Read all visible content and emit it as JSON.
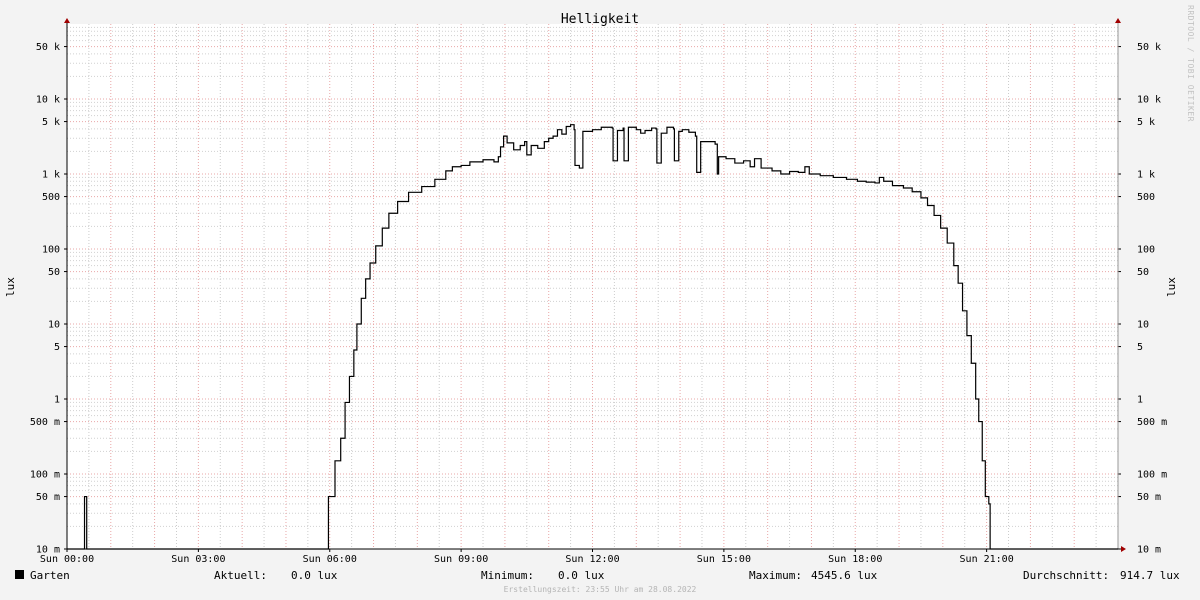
{
  "chart_data": {
    "type": "line",
    "title": "Helligkeit",
    "ylabel": "lux",
    "yscale": "log",
    "ylim": [
      0.01,
      100000
    ],
    "xlim": [
      "Sun 00:00",
      "Sun 24:00"
    ],
    "grid": true,
    "y_ticks": [
      {
        "value": 0.01,
        "label": "10 m"
      },
      {
        "value": 0.05,
        "label": "50 m"
      },
      {
        "value": 0.1,
        "label": "100 m"
      },
      {
        "value": 0.5,
        "label": "500 m"
      },
      {
        "value": 1,
        "label": "1"
      },
      {
        "value": 5,
        "label": "5"
      },
      {
        "value": 10,
        "label": "10"
      },
      {
        "value": 50,
        "label": "50"
      },
      {
        "value": 100,
        "label": "100"
      },
      {
        "value": 500,
        "label": "500"
      },
      {
        "value": 1000,
        "label": "1 k"
      },
      {
        "value": 5000,
        "label": "5 k"
      },
      {
        "value": 10000,
        "label": "10 k"
      },
      {
        "value": 50000,
        "label": "50 k"
      }
    ],
    "x_ticks": [
      {
        "hour": 0,
        "label": "Sun 00:00"
      },
      {
        "hour": 3,
        "label": "Sun 03:00"
      },
      {
        "hour": 6,
        "label": "Sun 06:00"
      },
      {
        "hour": 9,
        "label": "Sun 09:00"
      },
      {
        "hour": 12,
        "label": "Sun 12:00"
      },
      {
        "hour": 15,
        "label": "Sun 15:00"
      },
      {
        "hour": 18,
        "label": "Sun 18:00"
      },
      {
        "hour": 21,
        "label": "Sun 21:00"
      }
    ],
    "series": [
      {
        "name": "Garten",
        "color": "#000000",
        "points": [
          [
            0.0,
            0.01
          ],
          [
            0.4,
            0.01
          ],
          [
            0.4,
            0.05
          ],
          [
            0.45,
            0.05
          ],
          [
            0.45,
            0.01
          ],
          [
            5.97,
            0.01
          ],
          [
            5.97,
            0.05
          ],
          [
            6.1,
            0.05
          ],
          [
            6.12,
            0.15
          ],
          [
            6.25,
            0.3
          ],
          [
            6.35,
            0.9
          ],
          [
            6.45,
            2.0
          ],
          [
            6.55,
            4.5
          ],
          [
            6.62,
            10
          ],
          [
            6.72,
            22
          ],
          [
            6.82,
            40
          ],
          [
            6.92,
            65
          ],
          [
            7.05,
            110
          ],
          [
            7.2,
            190
          ],
          [
            7.35,
            300
          ],
          [
            7.55,
            430
          ],
          [
            7.8,
            570
          ],
          [
            8.1,
            680
          ],
          [
            8.4,
            850
          ],
          [
            8.65,
            1100
          ],
          [
            8.8,
            1250
          ],
          [
            9.0,
            1300
          ],
          [
            9.2,
            1450
          ],
          [
            9.5,
            1550
          ],
          [
            9.75,
            1450
          ],
          [
            9.85,
            1700
          ],
          [
            9.9,
            2300
          ],
          [
            9.97,
            3200
          ],
          [
            10.05,
            2600
          ],
          [
            10.2,
            2100
          ],
          [
            10.35,
            2400
          ],
          [
            10.45,
            2700
          ],
          [
            10.5,
            1800
          ],
          [
            10.6,
            2400
          ],
          [
            10.75,
            2200
          ],
          [
            10.9,
            2700
          ],
          [
            11.0,
            3000
          ],
          [
            11.1,
            3200
          ],
          [
            11.2,
            3900
          ],
          [
            11.3,
            3400
          ],
          [
            11.4,
            4300
          ],
          [
            11.5,
            4545.6
          ],
          [
            11.58,
            3900
          ],
          [
            11.6,
            1300
          ],
          [
            11.7,
            1200
          ],
          [
            11.78,
            3700
          ],
          [
            12.0,
            3900
          ],
          [
            12.2,
            4200
          ],
          [
            12.45,
            4100
          ],
          [
            12.47,
            1500
          ],
          [
            12.55,
            1500
          ],
          [
            12.57,
            3800
          ],
          [
            12.7,
            4100
          ],
          [
            12.72,
            1500
          ],
          [
            12.8,
            1500
          ],
          [
            12.82,
            4200
          ],
          [
            13.0,
            3900
          ],
          [
            13.1,
            3500
          ],
          [
            13.2,
            3800
          ],
          [
            13.35,
            4100
          ],
          [
            13.45,
            4000
          ],
          [
            13.47,
            1400
          ],
          [
            13.55,
            1400
          ],
          [
            13.57,
            3500
          ],
          [
            13.7,
            4200
          ],
          [
            13.85,
            4000
          ],
          [
            13.87,
            1500
          ],
          [
            13.95,
            1500
          ],
          [
            13.97,
            3700
          ],
          [
            14.05,
            3900
          ],
          [
            14.2,
            3600
          ],
          [
            14.35,
            3200
          ],
          [
            14.38,
            1050
          ],
          [
            14.45,
            1050
          ],
          [
            14.47,
            2700
          ],
          [
            14.65,
            2700
          ],
          [
            14.8,
            2500
          ],
          [
            14.85,
            1000
          ],
          [
            14.88,
            1700
          ],
          [
            15.05,
            1600
          ],
          [
            15.25,
            1400
          ],
          [
            15.45,
            1500
          ],
          [
            15.6,
            1250
          ],
          [
            15.7,
            1600
          ],
          [
            15.85,
            1200
          ],
          [
            16.1,
            1100
          ],
          [
            16.3,
            1000
          ],
          [
            16.5,
            1080
          ],
          [
            16.7,
            1050
          ],
          [
            16.85,
            1250
          ],
          [
            16.95,
            1000
          ],
          [
            17.2,
            950
          ],
          [
            17.5,
            900
          ],
          [
            17.8,
            850
          ],
          [
            18.05,
            800
          ],
          [
            18.25,
            780
          ],
          [
            18.45,
            760
          ],
          [
            18.55,
            900
          ],
          [
            18.65,
            800
          ],
          [
            18.85,
            700
          ],
          [
            19.1,
            650
          ],
          [
            19.3,
            580
          ],
          [
            19.5,
            480
          ],
          [
            19.65,
            380
          ],
          [
            19.8,
            280
          ],
          [
            19.95,
            190
          ],
          [
            20.1,
            120
          ],
          [
            20.25,
            60
          ],
          [
            20.35,
            35
          ],
          [
            20.45,
            15
          ],
          [
            20.55,
            7.0
          ],
          [
            20.65,
            3.0
          ],
          [
            20.75,
            1.0
          ],
          [
            20.82,
            0.5
          ],
          [
            20.9,
            0.15
          ],
          [
            20.97,
            0.05
          ],
          [
            21.0,
            0.05
          ],
          [
            21.02,
            0.05
          ],
          [
            21.05,
            0.04
          ],
          [
            21.08,
            0.01
          ],
          [
            24.0,
            0.01
          ]
        ]
      }
    ]
  },
  "legend": {
    "series_name": "Garten",
    "current_label": "Aktuell:",
    "current_value": "0.0 lux",
    "minimum_label": "Minimum:",
    "minimum_value": "0.0 lux",
    "maximum_label": "Maximum:",
    "maximum_value": "4545.6 lux",
    "average_label": "Durchschnitt:",
    "average_value": "914.7 lux"
  },
  "footer": "Erstellungszeit: 23:55 Uhr am 28.08.2022",
  "watermark": "RRDTOOL / TOBI OETIKER",
  "colors": {
    "background": "#f3f3f3",
    "plot_area": "#ffffff",
    "major_grid": "#e9a7a7",
    "minor_grid": "#cccccc",
    "axis": "#000000",
    "arrow": "#a00000"
  }
}
